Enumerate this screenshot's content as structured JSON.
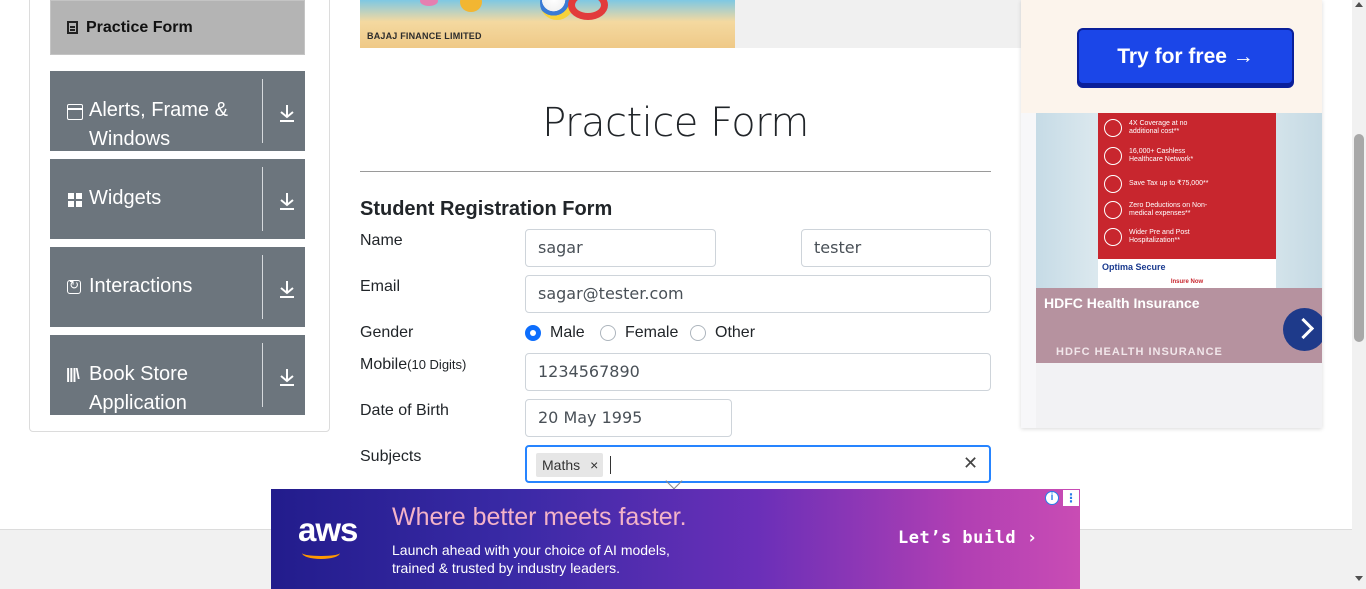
{
  "sidebar": {
    "active_item": "Practice Form",
    "groups": [
      {
        "label_line1": "Alerts, Frame &",
        "label_line2": "Windows",
        "icon": "window-icon"
      },
      {
        "label_line1": "Widgets",
        "label_line2": "",
        "icon": "widgets-icon"
      },
      {
        "label_line1": "Interactions",
        "label_line2": "",
        "icon": "interactions-icon"
      },
      {
        "label_line1": "Book Store",
        "label_line2": "Application",
        "icon": "book-store-icon"
      }
    ]
  },
  "banner": {
    "company": "BAJAJ FINANCE LIMITED"
  },
  "page": {
    "title": "Practice Form"
  },
  "form": {
    "heading": "Student Registration Form",
    "name": {
      "label": "Name",
      "first": "sagar",
      "last": "tester"
    },
    "email": {
      "label": "Email",
      "value": "sagar@tester.com"
    },
    "gender": {
      "label": "Gender",
      "options": [
        "Male",
        "Female",
        "Other"
      ],
      "selected": "Male"
    },
    "mobile": {
      "label": "Mobile",
      "hint": "(10 Digits)",
      "value": "1234567890"
    },
    "dob": {
      "label": "Date of Birth",
      "value": "20 May 1995"
    },
    "subjects": {
      "label": "Subjects",
      "chips": [
        "Maths"
      ],
      "chip_remove": "×",
      "clear": "✕"
    }
  },
  "ad_right": {
    "cta": "Try for free →",
    "features": [
      "4X Coverage at no additional cost**",
      "16,000+ Cashless Healthcare Network*",
      "Save Tax up to ₹75,000**",
      "Zero Deductions on Non-medical expenses**",
      "Wider Pre and Post Hospitalization**"
    ],
    "product": "Optima Secure",
    "insure_now": "Insure Now",
    "title": "HDFC Health Insurance",
    "brand": "HDFC HEALTH INSURANCE"
  },
  "ad_bottom": {
    "logo": "aws",
    "headline": "Where better meets faster.",
    "sub_line1": "Launch ahead with your choice of AI models,",
    "sub_line2": "trained & trusted by industry leaders.",
    "cta": "Let’s build ›",
    "info": "i",
    "menu": "⋮"
  },
  "colors": {
    "accent": "#0d6efd",
    "sidebar_group": "#6c757d",
    "active_item": "#b4b4b4",
    "focus": "#2684ff"
  }
}
